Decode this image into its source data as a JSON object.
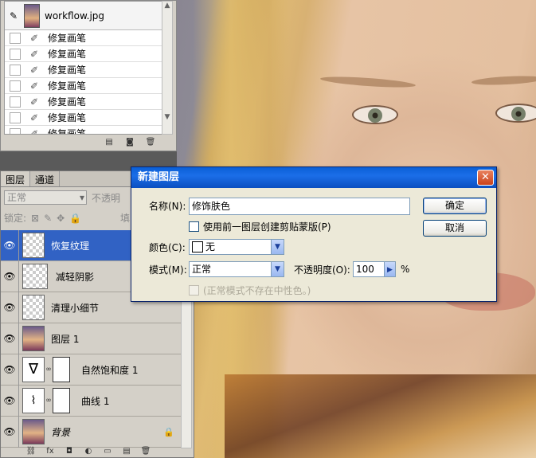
{
  "history": {
    "snapshot_name": "workflow.jpg",
    "steps": [
      "修复画笔",
      "修复画笔",
      "修复画笔",
      "修复画笔",
      "修复画笔",
      "修复画笔",
      "修复画笔"
    ]
  },
  "layers_panel": {
    "tabs": [
      "图层",
      "通道"
    ],
    "blend_mode": "正常",
    "opacity_label": "不透明",
    "lock_label": "锁定:",
    "fill_label": "填",
    "layers": [
      {
        "name": "恢复纹理",
        "selected": true
      },
      {
        "name": "减轻阴影"
      },
      {
        "name": "清理小细节"
      },
      {
        "name": "图层 1"
      },
      {
        "name": "自然饱和度 1",
        "icon": "vibrance-icon"
      },
      {
        "name": "曲线 1",
        "icon": "curves-icon"
      },
      {
        "name": "背景"
      }
    ]
  },
  "dialog": {
    "title": "新建图层",
    "name_label": "名称(N):",
    "name_value": "修饰肤色",
    "clip_label": "使用前一图层创建剪贴蒙版(P)",
    "color_label": "颜色(C):",
    "color_value": "无",
    "mode_label": "模式(M):",
    "mode_value": "正常",
    "opacity_label": "不透明度(O):",
    "opacity_value": "100",
    "percent": "%",
    "neutral_label": "(正常模式不存在中性色。)",
    "ok_label": "确定",
    "cancel_label": "取消",
    "close_symbol": "✕"
  }
}
